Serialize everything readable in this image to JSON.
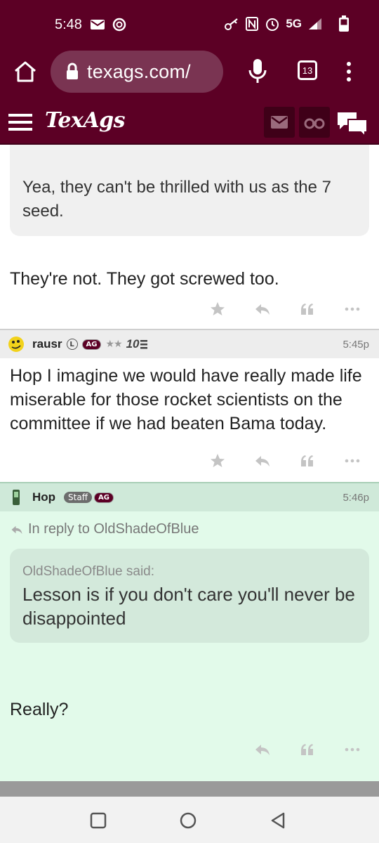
{
  "status": {
    "time": "5:48",
    "network": "5G",
    "icons": [
      "mail-icon",
      "chrome-icon",
      "key-icon",
      "nfc-icon",
      "alarm-icon",
      "signal-icon",
      "battery-icon"
    ]
  },
  "browser": {
    "url": "texags.com/",
    "tab_count": "13"
  },
  "site": {
    "logo": "TexAgs"
  },
  "posts": {
    "first": {
      "quote_text": "Yea, they can't be thrilled with us as the 7 seed.",
      "body": "They're not. They got screwed too."
    },
    "second": {
      "username": "rausr",
      "badge_l": "L",
      "badge_ag": "AG",
      "stars": "★★",
      "level": "10",
      "time": "5:45p",
      "body": "Hop I imagine we would have really made life miserable for those rocket scientists on the committee if we had beaten Bama today."
    },
    "third": {
      "username": "Hop",
      "badge_staff": "Staff",
      "badge_ag": "AG",
      "time": "5:46p",
      "reply_ref": "In reply to OldShadeOfBlue",
      "quote_author": "OldShadeOfBlue said:",
      "quote_text": "Lesson is if you don't care you'll never be disappointed",
      "body": "Really?"
    }
  },
  "colors": {
    "maroon": "#5c0025",
    "staff_bg": "#e2faea"
  }
}
